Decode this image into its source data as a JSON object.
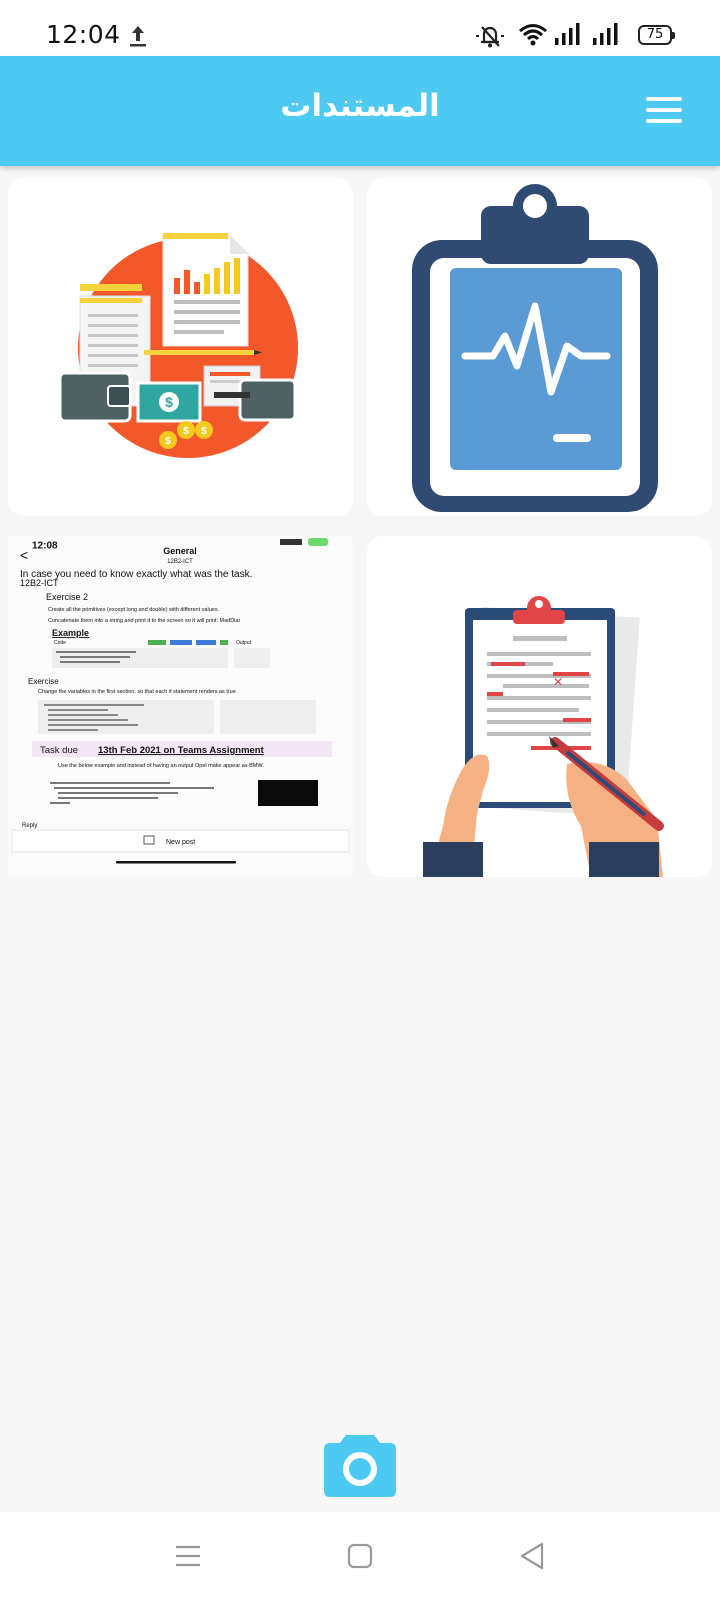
{
  "status_bar": {
    "time": "12:04",
    "battery": "75",
    "icons": [
      "upload-icon",
      "mute-icon",
      "wifi-icon",
      "signal-icon",
      "signal-icon",
      "battery-icon"
    ]
  },
  "app_bar": {
    "title": "المستندات",
    "menu_icon": "hamburger-menu-icon"
  },
  "documents": [
    {
      "name": "financial-documents",
      "icon": "finance-report-illustration"
    },
    {
      "name": "medical-report",
      "icon": "clipboard-heartbeat-illustration"
    },
    {
      "name": "teams-screenshot",
      "icon": "screenshot-thumbnail",
      "screenshot": {
        "time": "12:08",
        "channel": "General",
        "team": "12B2-ICT",
        "intro": "In case you need to know exactly what was the task.",
        "team_repeat": "12B2-ICT",
        "exercise2": "Exercise 2",
        "bullet1": "Create all the primitives (except long and double) with different values.",
        "bullet2": "Concatenate them into a string and print it to the screen so it will print: MadDiar",
        "example": "Example",
        "code_label": "Code",
        "output_label": "Output",
        "exercise": "Exercise",
        "bullet3": "Change the variables in the first section, so that each if statement renders as true",
        "task_prefix": "Task due ",
        "task_date": "13th Feb 2021 on Teams Assignment",
        "bullet4": "Use the below example and instead of having an output Opel make appear as BMW.",
        "reply": "Reply",
        "new_post": "New post"
      }
    },
    {
      "name": "contract-document",
      "icon": "signing-document-illustration"
    }
  ],
  "camera_fab": {
    "icon": "camera-icon"
  },
  "nav_bar": {
    "icons": [
      "recent-apps-icon",
      "home-icon",
      "back-icon"
    ]
  }
}
